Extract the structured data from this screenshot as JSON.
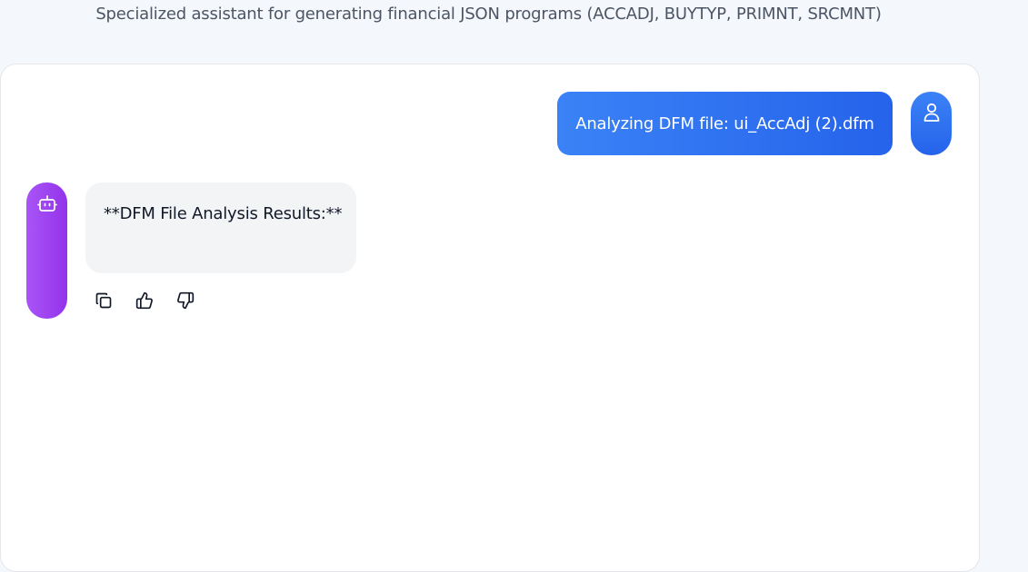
{
  "header": {
    "subtitle": "Specialized assistant for generating financial JSON programs (ACCADJ, BUYTYP, PRIMNT, SRCMNT)"
  },
  "messages": [
    {
      "role": "user",
      "text": "Analyzing DFM file: ui_AccAdj (2).dfm",
      "avatar_icon": "user-icon"
    },
    {
      "role": "assistant",
      "text": "**DFM File Analysis Results:**",
      "avatar_icon": "bot-icon",
      "actions": [
        "copy-icon",
        "thumbs-up-icon",
        "thumbs-down-icon"
      ]
    }
  ],
  "colors": {
    "user_bubble": "#3b82f6",
    "bot_avatar": "#a855f7",
    "bot_bubble": "#f3f4f6",
    "page_background": "#f4f7fb"
  }
}
